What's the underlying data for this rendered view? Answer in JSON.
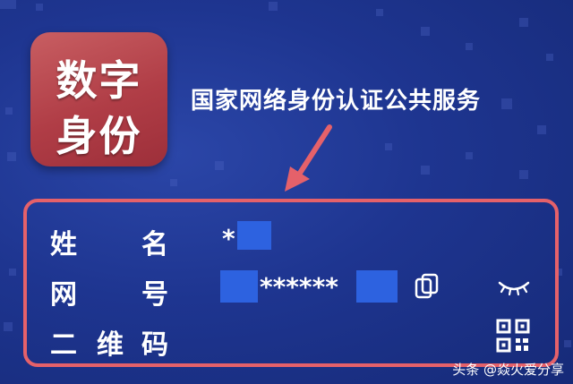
{
  "app_icon": {
    "line1": "数字",
    "line2": "身份",
    "bg_color": "#b03d46"
  },
  "service_title": "国家网络身份认证公共服务",
  "card": {
    "border_color": "#e5616a",
    "name_label_a": "姓",
    "name_label_b": "名",
    "name_value_prefix": "*",
    "id_label_a": "网",
    "id_label_b": "号",
    "id_value_masked": "******",
    "qr_label_a": "二",
    "qr_label_b": "维",
    "qr_label_c": "码",
    "mask_color": "#2d62e0"
  },
  "icons": [
    "copy-icon",
    "eye-closed-icon",
    "qr-code-icon",
    "arrow-icon"
  ],
  "watermark": "头条 @焱火爱分享"
}
